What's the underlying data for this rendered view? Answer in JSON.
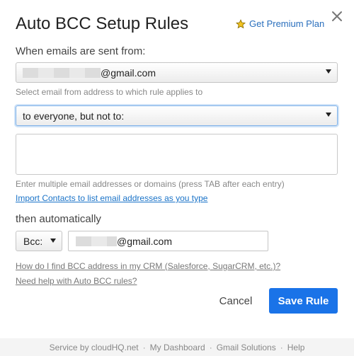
{
  "dialog": {
    "title": "Auto BCC Setup Rules",
    "premium_link": "Get Premium Plan",
    "colors": {
      "accent": "#1a73e8",
      "link": "#1a73c8",
      "star": "#f2c320"
    }
  },
  "from_section": {
    "label": "When emails are sent from:",
    "email_suffix": "@gmail.com",
    "hint": "Select email from address to which rule applies to"
  },
  "recipients": {
    "selected": "to everyone, but not to:",
    "textarea_value": "",
    "hint": "Enter multiple email addresses or domains (press TAB after each entry)",
    "import_link": "Import Contacts to list email addresses as you type"
  },
  "action": {
    "label": "then automatically",
    "mode": "Bcc:",
    "email_suffix": "@gmail.com"
  },
  "help_links": {
    "crm": "How do I find BCC address in my CRM (Salesforce, SugarCRM, etc.)?",
    "help": "Need help with Auto BCC rules?"
  },
  "buttons": {
    "cancel": "Cancel",
    "save": "Save Rule"
  },
  "footer": {
    "service": "Service by cloudHQ.net",
    "dashboard": "My Dashboard",
    "solutions": "Gmail Solutions",
    "help": "Help",
    "separator": "·"
  }
}
